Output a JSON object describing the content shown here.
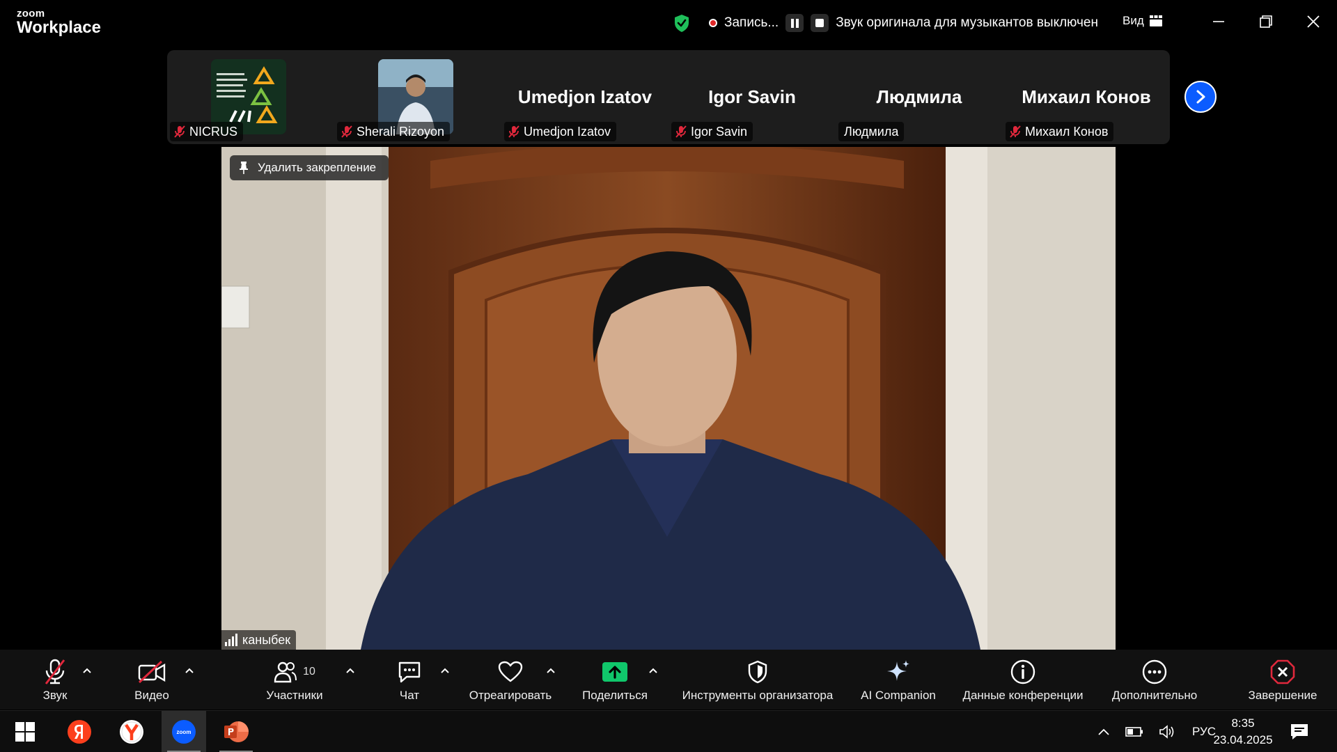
{
  "app": {
    "logo_line1": "zoom",
    "logo_line2": "Workplace"
  },
  "titlebar": {
    "recording_label": "Запись...",
    "original_sound_status": "Звук оригинала для музыкантов выключен",
    "view_label": "Вид"
  },
  "participants": [
    {
      "name": "NICRUS",
      "display": "",
      "thumbnail": "logo",
      "muted": true
    },
    {
      "name": "Sherali Rizoyon",
      "display": "",
      "thumbnail": "photo",
      "muted": true
    },
    {
      "name": "Umedjon Izatov",
      "display": "Umedjon Izatov",
      "muted": true
    },
    {
      "name": "Igor Savin",
      "display": "Igor Savin",
      "muted": true
    },
    {
      "name": "Людмила",
      "display": "Людмила",
      "muted": false
    },
    {
      "name": "Михаил Конов",
      "display": "Михаил Конов",
      "muted": true
    }
  ],
  "main_video": {
    "unpin_label": "Удалить закрепление",
    "speaker_name": "каныбек"
  },
  "toolbar": {
    "audio": "Звук",
    "video": "Видео",
    "participants": "Участники",
    "participants_count": "10",
    "chat": "Чат",
    "react": "Отреагировать",
    "share": "Поделиться",
    "host_tools": "Инструменты организатора",
    "ai_companion": "AI Companion",
    "meeting_info": "Данные конференции",
    "more": "Дополнительно",
    "end": "Завершение"
  },
  "taskbar": {
    "language": "РУС",
    "time": "8:35",
    "date": "23.04.2025",
    "zoom_label": "zoom"
  },
  "colors": {
    "accent": "#0b5cff",
    "recording": "#e02828",
    "shield": "#1fbf5a",
    "share": "#10c76b",
    "mute_slash": "#e0283c",
    "end": "#e0283c"
  }
}
